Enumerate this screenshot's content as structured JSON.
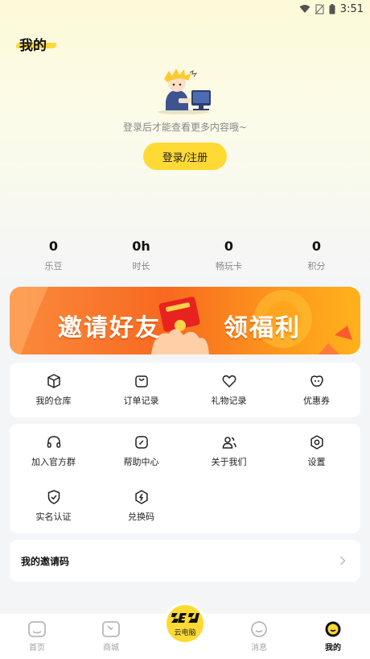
{
  "status_bar": {
    "time": "3:51",
    "icons": [
      "wifi-icon",
      "no-sim-icon",
      "battery-icon"
    ]
  },
  "header": {
    "title": "我的"
  },
  "profile": {
    "hint": "登录后才能查看更多内容哦~",
    "login_label": "登录/注册"
  },
  "stats": [
    {
      "value": "0",
      "label": "乐豆"
    },
    {
      "value": "0h",
      "label": "时长"
    },
    {
      "value": "0",
      "label": "畅玩卡"
    },
    {
      "value": "0",
      "label": "积分"
    }
  ],
  "banner": {
    "left_text": "邀请好友",
    "right_text": "领福利"
  },
  "orders": [
    {
      "label": "我的仓库",
      "icon": "box-icon"
    },
    {
      "label": "订单记录",
      "icon": "bag-icon"
    },
    {
      "label": "礼物记录",
      "icon": "heart-icon"
    },
    {
      "label": "优惠券",
      "icon": "coupon-icon"
    }
  ],
  "services": [
    {
      "label": "加入官方群",
      "icon": "headset-icon"
    },
    {
      "label": "帮助中心",
      "icon": "help-icon"
    },
    {
      "label": "关于我们",
      "icon": "users-icon"
    },
    {
      "label": "设置",
      "icon": "settings-icon"
    },
    {
      "label": "实名认证",
      "icon": "shield-check-icon"
    },
    {
      "label": "兑换码",
      "icon": "lightning-icon"
    }
  ],
  "invite": {
    "label": "我的邀请码"
  },
  "tabbar": {
    "tabs": [
      {
        "label": "首页",
        "icon": "home-icon"
      },
      {
        "label": "商城",
        "icon": "shop-icon"
      },
      {
        "label": "云电脑",
        "icon": "cloud-pc-logo"
      },
      {
        "label": "消息",
        "icon": "message-icon"
      },
      {
        "label": "我的",
        "icon": "profile-icon"
      }
    ],
    "active": "我的"
  },
  "colors": {
    "accent": "#ffd934",
    "banner_orange": "#f7691f",
    "text_muted": "#888888"
  }
}
